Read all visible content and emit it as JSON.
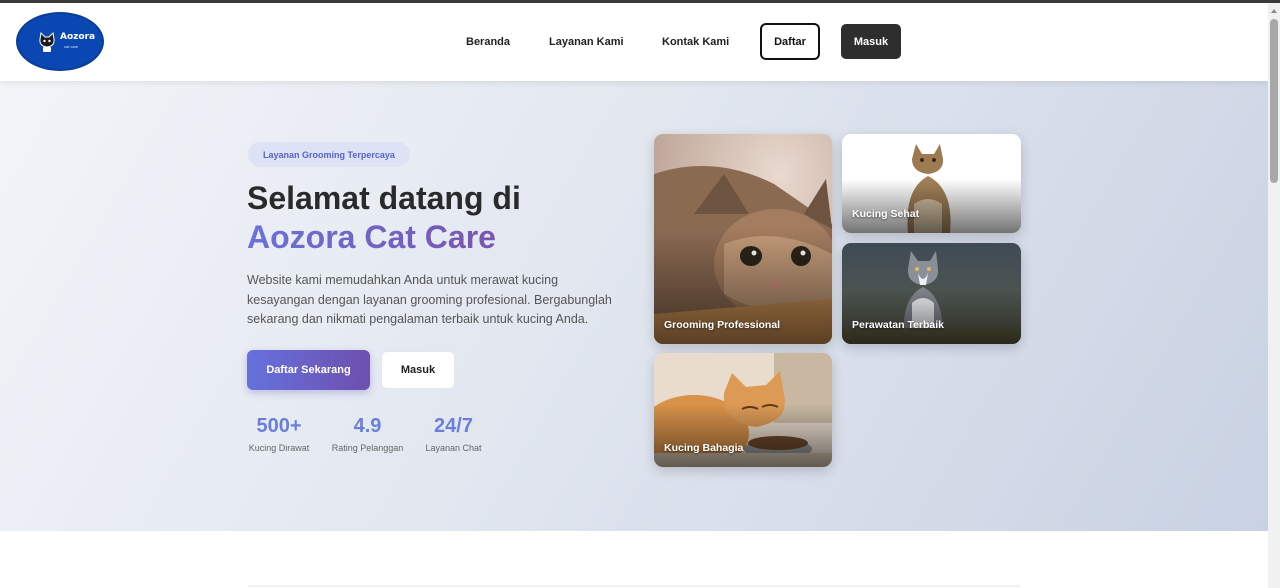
{
  "brand": {
    "name": "Aozora",
    "tagline": "cat care"
  },
  "nav": {
    "links": [
      "Beranda",
      "Layanan Kami",
      "Kontak Kami"
    ],
    "register_label": "Daftar",
    "login_label": "Masuk"
  },
  "hero": {
    "badge": "Layanan Grooming Terpercaya",
    "title_line1": "Selamat datang di",
    "title_line2": "Aozora Cat Care",
    "description": "Website kami memudahkan Anda untuk merawat kucing kesayangan dengan layanan grooming profesional. Bergabunglah sekarang dan nikmati pengalaman terbaik untuk kucing Anda.",
    "cta_primary": "Daftar Sekarang",
    "cta_secondary": "Masuk",
    "stats": [
      {
        "value": "500+",
        "label": "Kucing Dirawat"
      },
      {
        "value": "4.9",
        "label": "Rating Pelanggan"
      },
      {
        "value": "24/7",
        "label": "Layanan Chat"
      }
    ]
  },
  "gallery": [
    {
      "label": "Grooming Professional",
      "icon": "tabby-cat-closeup-photo"
    },
    {
      "label": "Kucing Sehat",
      "icon": "sitting-tabby-cat-photo"
    },
    {
      "label": "Perawatan Terbaik",
      "icon": "grey-white-cat-photo"
    },
    {
      "label": "Kucing Bahagia",
      "icon": "orange-cat-eating-photo"
    }
  ],
  "colors": {
    "accent": "#6a72d8",
    "accent_dark": "#6e4fae",
    "header_logo_bg": "#0b47b3",
    "login_button_bg": "#2e2e2e"
  }
}
